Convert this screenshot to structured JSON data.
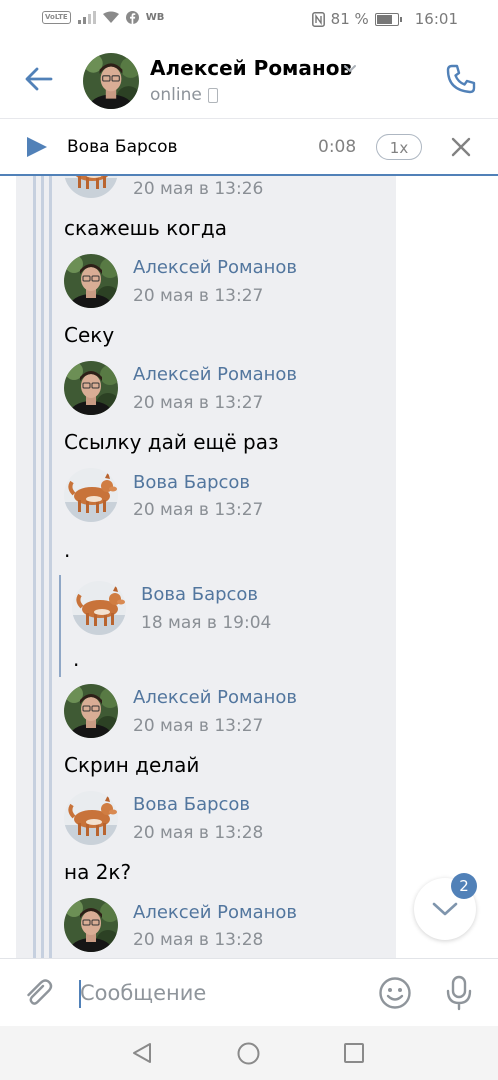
{
  "status_bar": {
    "volte": "VoLTE",
    "carrier_tag": "WB",
    "battery_text": "81 %",
    "battery_level": 0.81,
    "time": "16:01"
  },
  "header": {
    "contact_name": "Алексей Романов",
    "status": "online"
  },
  "player": {
    "title": "Вова Барсов",
    "time": "0:08",
    "speed": "1x"
  },
  "chat": {
    "messages": [
      {
        "author": "",
        "date": "20 мая в 13:26",
        "avatar": "dog",
        "text": "скажешь когда"
      },
      {
        "author": "Алексей Романов",
        "date": "20 мая в 13:27",
        "avatar": "man",
        "text": "Секу"
      },
      {
        "author": "Алексей Романов",
        "date": "20 мая в 13:27",
        "avatar": "man",
        "text": "Ссылку дай ещё раз"
      },
      {
        "author": "Вова Барсов",
        "date": "20 мая в 13:27",
        "avatar": "dog",
        "text": "."
      },
      {
        "author": "Алексей Романов",
        "date": "20 мая в 13:27",
        "avatar": "man",
        "text": "Скрин делай"
      },
      {
        "author": "Вова Барсов",
        "date": "20 мая в 13:28",
        "avatar": "dog",
        "text": "на 2к?"
      },
      {
        "author": "Алексей Романов",
        "date": "20 мая в 13:28",
        "avatar": "man",
        "text": ""
      }
    ],
    "nested_quote": {
      "author": "Вова Барсов",
      "date": "18 мая в 19:04",
      "avatar": "dog",
      "text": "."
    }
  },
  "scroll_down": {
    "badge": "2"
  },
  "composer": {
    "placeholder": "Сообщение"
  },
  "colors": {
    "accent": "#5181b8",
    "author_link": "#52769e",
    "chat_background": "#eeeff2",
    "quote_bar": "#c6d0df"
  },
  "icons": [
    "back-arrow-icon",
    "chevron-down-icon",
    "phone-icon",
    "call-icon",
    "play-icon",
    "close-icon",
    "chevron-down-icon",
    "paperclip-icon",
    "emoji-icon",
    "microphone-icon",
    "nav-back-icon",
    "nav-home-icon",
    "nav-recent-icon"
  ]
}
